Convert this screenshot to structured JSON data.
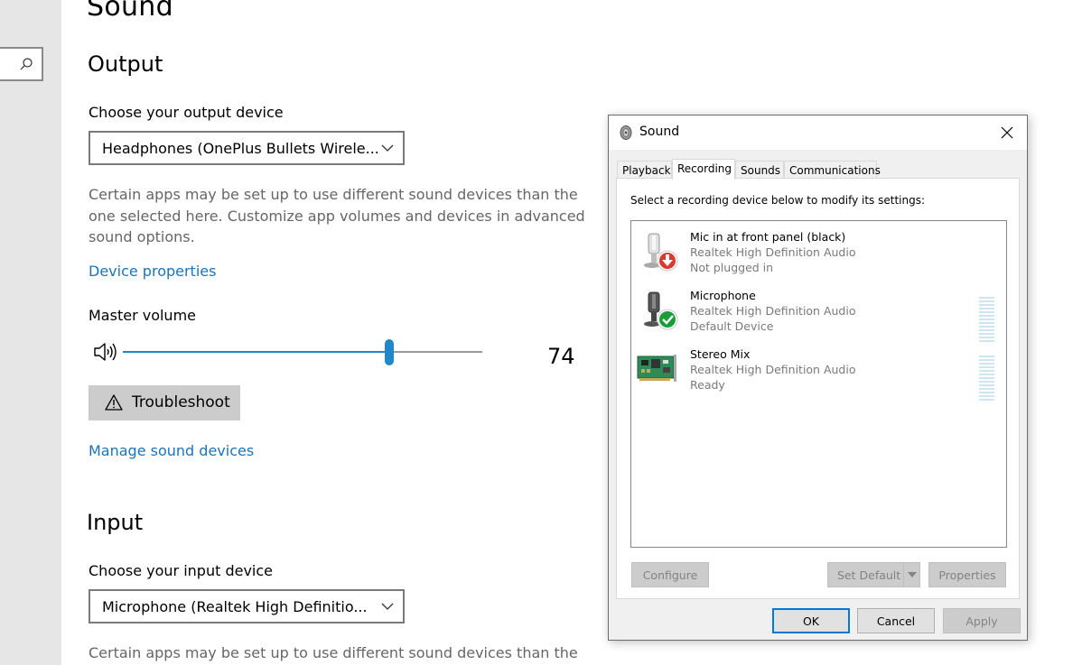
{
  "settings": {
    "page_title": "Sound",
    "output": {
      "heading": "Output",
      "device_label": "Choose your output device",
      "device_value": "Headphones (OnePlus Bullets Wirele...",
      "description": "Certain apps may be set up to use different sound devices than the one selected here. Customize app volumes and devices in advanced sound options.",
      "device_properties_link": "Device properties",
      "master_volume_label": "Master volume",
      "master_volume_value": "74",
      "master_volume_fraction": 0.74,
      "troubleshoot_label": "Troubleshoot",
      "manage_devices_link": "Manage sound devices"
    },
    "input": {
      "heading": "Input",
      "device_label": "Choose your input device",
      "device_value": "Microphone (Realtek High Definitio...",
      "description": "Certain apps may be set up to use different sound devices than the one"
    }
  },
  "dialog": {
    "title": "Sound",
    "tabs": [
      {
        "label": "Playback",
        "active": false
      },
      {
        "label": "Recording",
        "active": true
      },
      {
        "label": "Sounds",
        "active": false
      },
      {
        "label": "Communications",
        "active": false
      }
    ],
    "instruction": "Select a recording device below to modify its settings:",
    "devices": [
      {
        "name": "Mic in at front panel (black)",
        "driver": "Realtek High Definition Audio",
        "status": "Not plugged in",
        "icon": "microphone-unplugged-icon",
        "has_level_meter": false
      },
      {
        "name": "Microphone",
        "driver": "Realtek High Definition Audio",
        "status": "Default Device",
        "icon": "microphone-default-icon",
        "has_level_meter": true
      },
      {
        "name": "Stereo Mix",
        "driver": "Realtek High Definition Audio",
        "status": "Ready",
        "icon": "sound-card-icon",
        "has_level_meter": true
      }
    ],
    "buttons": {
      "configure": "Configure",
      "set_default": "Set Default",
      "properties": "Properties",
      "ok": "OK",
      "cancel": "Cancel",
      "apply": "Apply"
    }
  },
  "colors": {
    "accent": "#1e88c8",
    "link": "#1a74b8",
    "sidebar": "#e6e6e6",
    "dialog_bg": "#f0f0f0"
  }
}
